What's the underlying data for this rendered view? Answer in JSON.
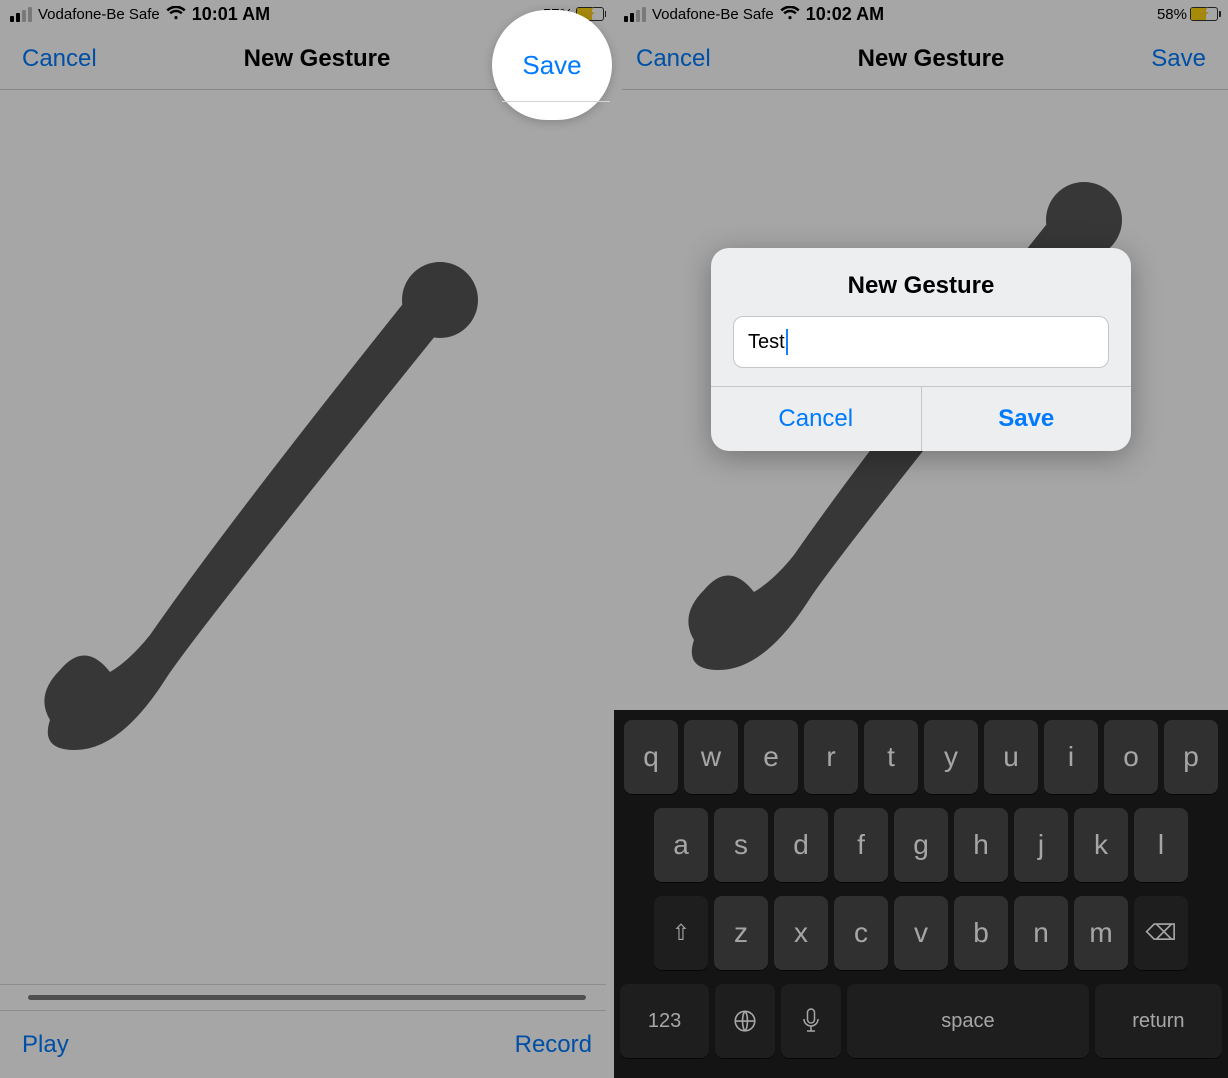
{
  "left": {
    "status": {
      "carrier": "Vodafone-Be Safe",
      "time": "10:01 AM",
      "battery_pct": "57%",
      "battery_fill": 57
    },
    "nav": {
      "cancel": "Cancel",
      "title": "New Gesture",
      "save": "Save"
    },
    "toolbar": {
      "play": "Play",
      "record": "Record"
    },
    "highlight": {
      "save": "Save"
    }
  },
  "right": {
    "status": {
      "carrier": "Vodafone-Be Safe",
      "time": "10:02 AM",
      "battery_pct": "58%",
      "battery_fill": 58
    },
    "nav": {
      "cancel": "Cancel",
      "title": "New Gesture",
      "save": "Save"
    },
    "alert": {
      "title": "New Gesture",
      "input_value": "Test",
      "cancel": "Cancel",
      "save": "Save"
    },
    "keyboard": {
      "row1": [
        "q",
        "w",
        "e",
        "r",
        "t",
        "y",
        "u",
        "i",
        "o",
        "p"
      ],
      "row2": [
        "a",
        "s",
        "d",
        "f",
        "g",
        "h",
        "j",
        "k",
        "l"
      ],
      "row3": [
        "z",
        "x",
        "c",
        "v",
        "b",
        "n",
        "m"
      ],
      "shift": "⇧",
      "backspace": "⌫",
      "num": "123",
      "globe": "🌐",
      "mic_icon": "mic",
      "space": "space",
      "return": "return"
    }
  }
}
